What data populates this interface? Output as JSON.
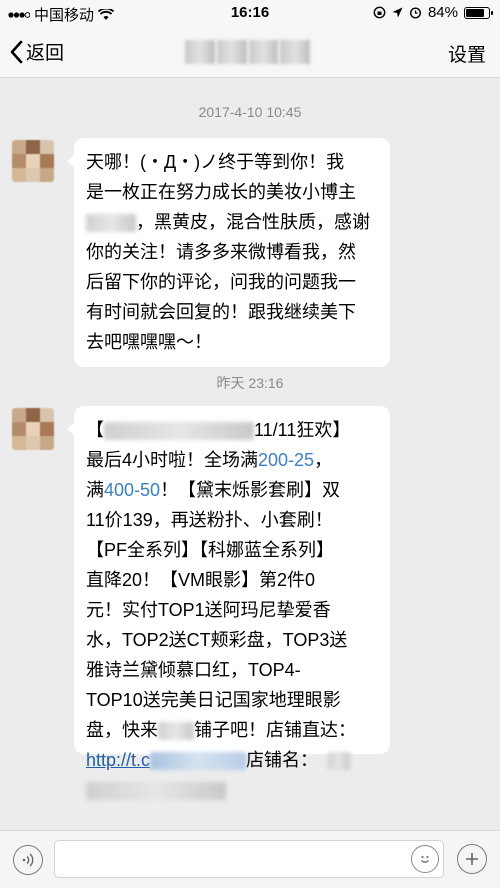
{
  "status_bar": {
    "carrier": "中国移动",
    "time": "16:16",
    "battery": "84%",
    "battery_level": 0.84
  },
  "nav": {
    "back_label": "返回",
    "settings_label": "设置"
  },
  "messages": [
    {
      "timestamp": "2017-4-10 10:45",
      "lines": {
        "l1": "天哪！(・Д・)ノ终于等到你！我",
        "l2": "是一枚正在努力成长的美妆小博主",
        "l3": "，黑黄皮，混合性肤质，感谢",
        "l4": "你的关注！请多多来微博看我，然",
        "l5": "后留下你的评论，问我的问题我一",
        "l6": "有时间就会回复的！跟我继续美下",
        "l7": "去吧嘿嘿嘿～！"
      }
    },
    {
      "timestamp": "昨天 23:16",
      "lines": {
        "l1a": "【",
        "l1b": "11/11狂欢】",
        "l2a": "最后4小时啦！全场满",
        "l2b": "200-25",
        "l2c": "，",
        "l3a": "满",
        "l3b": "400-50",
        "l3c": "！【黛末烁影套刷】双",
        "l4": "11价139，再送粉扑、小套刷！",
        "l5": "【PF全系列】【科娜蓝全系列】",
        "l6": "直降20！【VM眼影】第2件0",
        "l7": "元！实付TOP1送阿玛尼挚爱香",
        "l8": "水，TOP2送CT颊彩盘，TOP3送",
        "l9": "雅诗兰黛倾慕口红，TOP4-",
        "l10": "TOP10送完美日记国家地理眼影",
        "l11a": "盘，快来",
        "l11b": "铺子吧！店铺直达：",
        "l12a": "http://t.c",
        "l12b": "店铺名："
      }
    }
  ]
}
